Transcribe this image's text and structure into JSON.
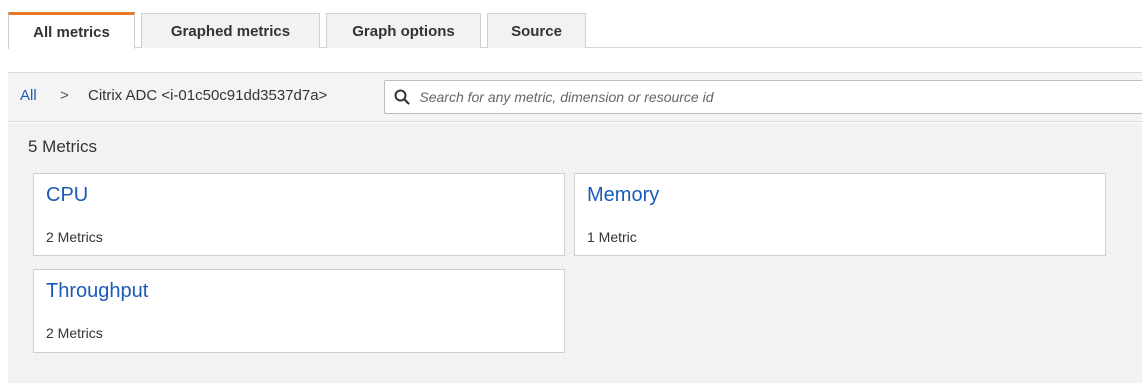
{
  "tabs": [
    {
      "label": "All metrics",
      "active": true
    },
    {
      "label": "Graphed metrics",
      "active": false
    },
    {
      "label": "Graph options",
      "active": false
    },
    {
      "label": "Source",
      "active": false
    }
  ],
  "breadcrumb": {
    "root": "All",
    "separator": ">",
    "current": "Citrix ADC <i-01c50c91dd3537d7a>"
  },
  "search": {
    "placeholder": "Search for any metric, dimension or resource id",
    "icon": "search-icon"
  },
  "metrics": {
    "count_label": "5 Metrics",
    "categories": [
      {
        "name": "CPU",
        "count": "2 Metrics"
      },
      {
        "name": "Memory",
        "count": "1 Metric"
      },
      {
        "name": "Throughput",
        "count": "2 Metrics"
      }
    ]
  },
  "colors": {
    "accent": "#e8792a",
    "link": "#1a5bb8",
    "panel_bg": "#f2f2f2"
  }
}
